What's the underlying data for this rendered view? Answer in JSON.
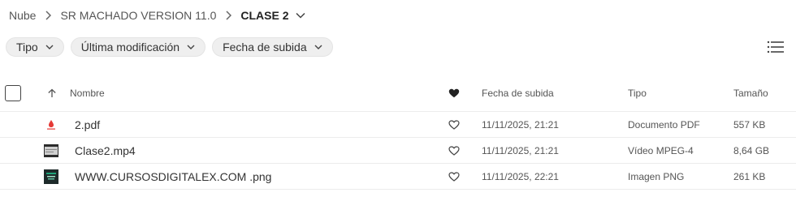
{
  "breadcrumb": {
    "items": [
      "Nube",
      "SR MACHADO VERSION 11.0"
    ],
    "current": "CLASE 2"
  },
  "filters": [
    {
      "label": "Tipo"
    },
    {
      "label": "Última modificación"
    },
    {
      "label": "Fecha de subida"
    }
  ],
  "table": {
    "headers": {
      "name": "Nombre",
      "uploaded": "Fecha de subida",
      "type": "Tipo",
      "size": "Tamaño"
    },
    "rows": [
      {
        "name": "2.pdf",
        "uploaded": "11/11/2025, 21:21",
        "type": "Documento PDF",
        "size": "557 KB",
        "icon": "pdf-icon"
      },
      {
        "name": "Clase2.mp4",
        "uploaded": "11/11/2025, 21:21",
        "type": "Vídeo MPEG-4",
        "size": "8,64 GB",
        "icon": "video-thumbnail"
      },
      {
        "name": "WWW.CURSOSDIGITALEX.COM .png",
        "uploaded": "11/11/2025, 22:21",
        "type": "Imagen PNG",
        "size": "261 KB",
        "icon": "image-thumbnail"
      }
    ]
  },
  "colors": {
    "pdf_red": "#e53935",
    "chip_bg": "#efefef",
    "text": "#333333"
  }
}
